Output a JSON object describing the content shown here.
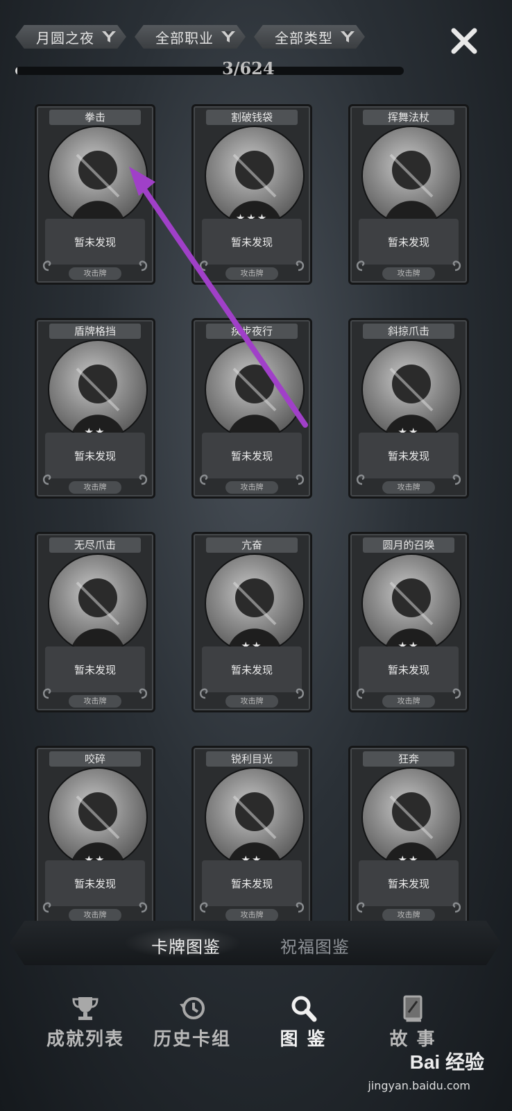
{
  "filters": [
    {
      "label": "月圆之夜",
      "icon": "funnel-icon"
    },
    {
      "label": "全部职业",
      "icon": "funnel-icon"
    },
    {
      "label": "全部类型",
      "icon": "funnel-icon"
    }
  ],
  "progress": {
    "text": "3/624",
    "collected": 3,
    "total": 624
  },
  "cards": [
    {
      "name": "拳击",
      "stars": "",
      "status": "暂未发现",
      "type": "攻击牌"
    },
    {
      "name": "割破钱袋",
      "stars": "★★★",
      "status": "暂未发现",
      "type": "攻击牌"
    },
    {
      "name": "挥舞法杖",
      "stars": "",
      "status": "暂未发现",
      "type": "攻击牌"
    },
    {
      "name": "盾牌格挡",
      "stars": "★★",
      "status": "暂未发现",
      "type": "攻击牌"
    },
    {
      "name": "疾步夜行",
      "stars": "",
      "status": "暂未发现",
      "type": "攻击牌"
    },
    {
      "name": "斜掠爪击",
      "stars": "★★",
      "status": "暂未发现",
      "type": "攻击牌"
    },
    {
      "name": "无尽爪击",
      "stars": "",
      "status": "暂未发现",
      "type": "攻击牌"
    },
    {
      "name": "亢奋",
      "stars": "★★",
      "status": "暂未发现",
      "type": "攻击牌"
    },
    {
      "name": "圆月的召唤",
      "stars": "★★",
      "status": "暂未发现",
      "type": "攻击牌"
    },
    {
      "name": "咬碎",
      "stars": "★★",
      "status": "暂未发现",
      "type": "攻击牌"
    },
    {
      "name": "锐利目光",
      "stars": "★★",
      "status": "暂未发现",
      "type": "攻击牌"
    },
    {
      "name": "狂奔",
      "stars": "★★",
      "status": "暂未发现",
      "type": "攻击牌"
    }
  ],
  "tabs": {
    "cards": "卡牌图鉴",
    "blessings": "祝福图鉴",
    "active": "cards"
  },
  "nav": [
    {
      "label": "成就列表",
      "icon": "trophy-icon"
    },
    {
      "label": "历史卡组",
      "icon": "history-icon"
    },
    {
      "label": "图 鉴",
      "icon": "magnifier-icon",
      "active": true
    },
    {
      "label": "故 事",
      "icon": "book-icon"
    }
  ],
  "watermark": {
    "brand": "Bai 经验",
    "url": "jingyan.baidu.com"
  },
  "colors": {
    "annotation_arrow": "#a040c8"
  }
}
